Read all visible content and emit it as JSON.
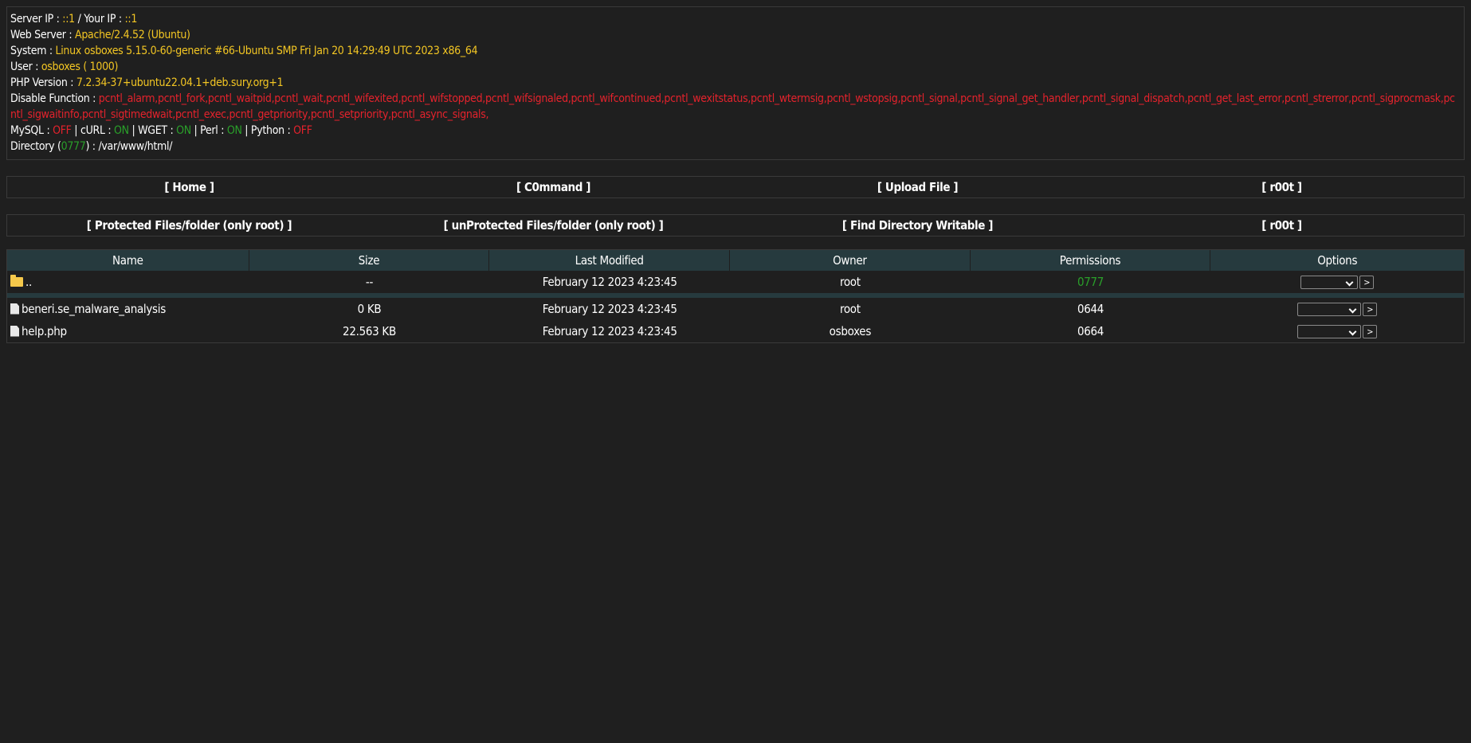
{
  "info": {
    "server_ip_label": "Server IP : ",
    "server_ip": "::1",
    "your_ip_sep": " / Your IP : ",
    "your_ip": "::1",
    "web_server_label": "Web Server : ",
    "web_server": "Apache/2.4.52 (Ubuntu)",
    "system_label": "System : ",
    "system": "Linux osboxes 5.15.0-60-generic #66-Ubuntu SMP Fri Jan 20 14:29:49 UTC 2023 x86_64",
    "user_label": "User : ",
    "user": "osboxes",
    "uid": " ( 1000)",
    "php_label": "PHP Version : ",
    "php": "7.2.34-37+ubuntu22.04.1+deb.sury.org+1",
    "disable_label": "Disable Function : ",
    "disable": "pcntl_alarm,pcntl_fork,pcntl_waitpid,pcntl_wait,pcntl_wifexited,pcntl_wifstopped,pcntl_wifsignaled,pcntl_wifcontinued,pcntl_wexitstatus,pcntl_wtermsig,pcntl_wstopsig,pcntl_signal,pcntl_signal_get_handler,pcntl_signal_dispatch,pcntl_get_last_error,pcntl_strerror,pcntl_sigprocmask,pcntl_sigwaitinfo,pcntl_sigtimedwait,pcntl_exec,pcntl_getpriority,pcntl_setpriority,pcntl_async_signals,",
    "mysql_label": "MySQL : ",
    "mysql": "OFF",
    "curl_label": " | cURL : ",
    "curl": "ON",
    "wget_label": " | WGET : ",
    "wget": "ON",
    "perl_label": " | Perl : ",
    "perl": "ON",
    "python_label": " | Python : ",
    "python": "OFF",
    "dir_label": "Directory (",
    "dir_perm": "0777",
    "dir_sep": ") : ",
    "dir_path": "/var/www/html/"
  },
  "nav1": [
    "[ Home ]",
    "[ C0mmand ]",
    "[ Upload File ]",
    "[ r00t ]"
  ],
  "nav2": [
    "[ Protected Files/folder (only root) ]",
    "[ unProtected Files/folder (only root) ]",
    "[ Find Directory Writable ]",
    "[ r00t ]"
  ],
  "table": {
    "headers": [
      "Name",
      "Size",
      "Last Modified",
      "Owner",
      "Permissions",
      "Options"
    ],
    "parent": {
      "name": "..",
      "size": "--",
      "modified": "February 12 2023 4:23:45",
      "owner": "root",
      "perm": "0777",
      "go": ">"
    },
    "files": [
      {
        "name": "beneri.se_malware_analysis",
        "size": "0 KB",
        "modified": "February 12 2023 4:23:45",
        "owner": "root",
        "perm": "0644",
        "go": ">"
      },
      {
        "name": "help.php",
        "size": "22.563 KB",
        "modified": "February 12 2023 4:23:45",
        "owner": "osboxes",
        "perm": "0664",
        "go": ">"
      }
    ]
  },
  "colors": {
    "yellow": "#f3c623",
    "red": "#e4222c",
    "green": "#2aa02a",
    "header_bg": "#263a3e",
    "bg": "#1f1f1f"
  }
}
